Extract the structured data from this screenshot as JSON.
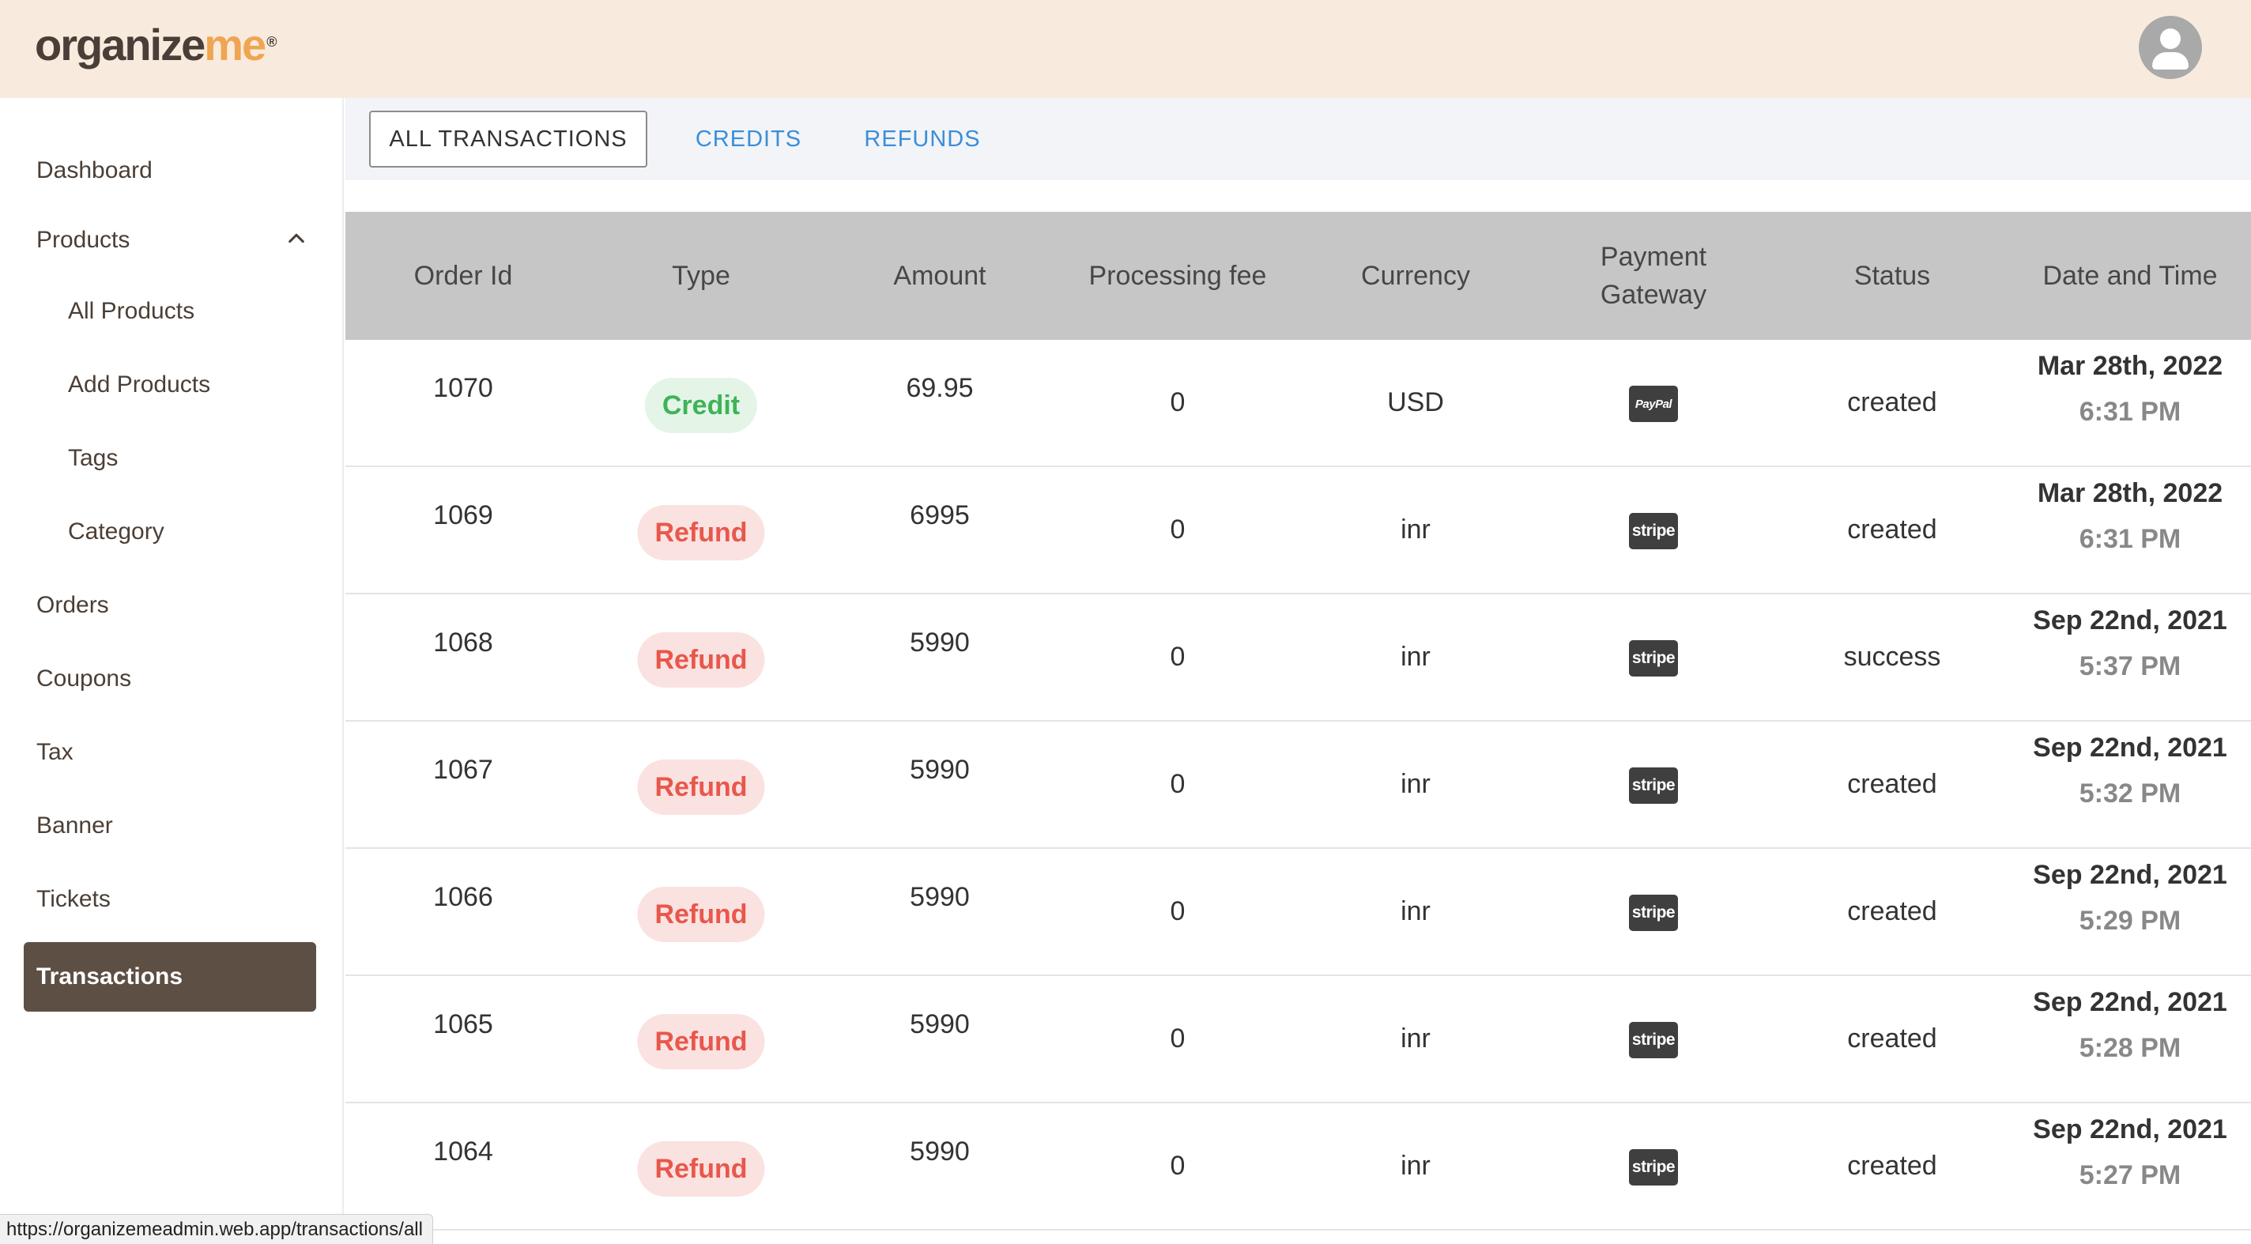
{
  "header": {
    "logo_part1": "organize",
    "logo_part2": "me",
    "logo_mark": "®",
    "avatar_icon": "user-avatar-icon"
  },
  "sidebar": {
    "items": [
      {
        "label": "Dashboard"
      },
      {
        "label": "Products"
      },
      {
        "label": "All Products"
      },
      {
        "label": "Add Products"
      },
      {
        "label": "Tags"
      },
      {
        "label": "Category"
      },
      {
        "label": "Orders"
      },
      {
        "label": "Coupons"
      },
      {
        "label": "Tax"
      },
      {
        "label": "Banner"
      },
      {
        "label": "Tickets"
      },
      {
        "label": "Transactions"
      }
    ],
    "active": "Transactions"
  },
  "tabs": [
    {
      "label": "ALL TRANSACTIONS"
    },
    {
      "label": "CREDITS"
    },
    {
      "label": "REFUNDS"
    }
  ],
  "table": {
    "headers": [
      "Order Id",
      "Type",
      "Amount",
      "Processing fee",
      "Currency",
      "Payment Gateway",
      "Status",
      "Date and Time"
    ],
    "rows": [
      {
        "order_id": "1070",
        "type": "Credit",
        "amount": "69.95",
        "fee": "0",
        "currency": "USD",
        "gateway": "PayPal",
        "status": "created",
        "date": "Mar 28th, 2022",
        "time": "6:31 PM"
      },
      {
        "order_id": "1069",
        "type": "Refund",
        "amount": "6995",
        "fee": "0",
        "currency": "inr",
        "gateway": "stripe",
        "status": "created",
        "date": "Mar 28th, 2022",
        "time": "6:31 PM"
      },
      {
        "order_id": "1068",
        "type": "Refund",
        "amount": "5990",
        "fee": "0",
        "currency": "inr",
        "gateway": "stripe",
        "status": "success",
        "date": "Sep 22nd, 2021",
        "time": "5:37 PM"
      },
      {
        "order_id": "1067",
        "type": "Refund",
        "amount": "5990",
        "fee": "0",
        "currency": "inr",
        "gateway": "stripe",
        "status": "created",
        "date": "Sep 22nd, 2021",
        "time": "5:32 PM"
      },
      {
        "order_id": "1066",
        "type": "Refund",
        "amount": "5990",
        "fee": "0",
        "currency": "inr",
        "gateway": "stripe",
        "status": "created",
        "date": "Sep 22nd, 2021",
        "time": "5:29 PM"
      },
      {
        "order_id": "1065",
        "type": "Refund",
        "amount": "5990",
        "fee": "0",
        "currency": "inr",
        "gateway": "stripe",
        "status": "created",
        "date": "Sep 22nd, 2021",
        "time": "5:28 PM"
      },
      {
        "order_id": "1064",
        "type": "Refund",
        "amount": "5990",
        "fee": "0",
        "currency": "inr",
        "gateway": "stripe",
        "status": "created",
        "date": "Sep 22nd, 2021",
        "time": "5:27 PM"
      }
    ]
  },
  "status_bar": {
    "url": "https://organizemeadmin.web.app/transactions/all"
  },
  "colors": {
    "header_bg": "#f8ebde",
    "active_nav_bg": "#5e4f45",
    "link_blue": "#3b8ed8",
    "credit_green": "#3fb357",
    "refund_red": "#e8574c",
    "table_header_bg": "#c6c6c6"
  }
}
